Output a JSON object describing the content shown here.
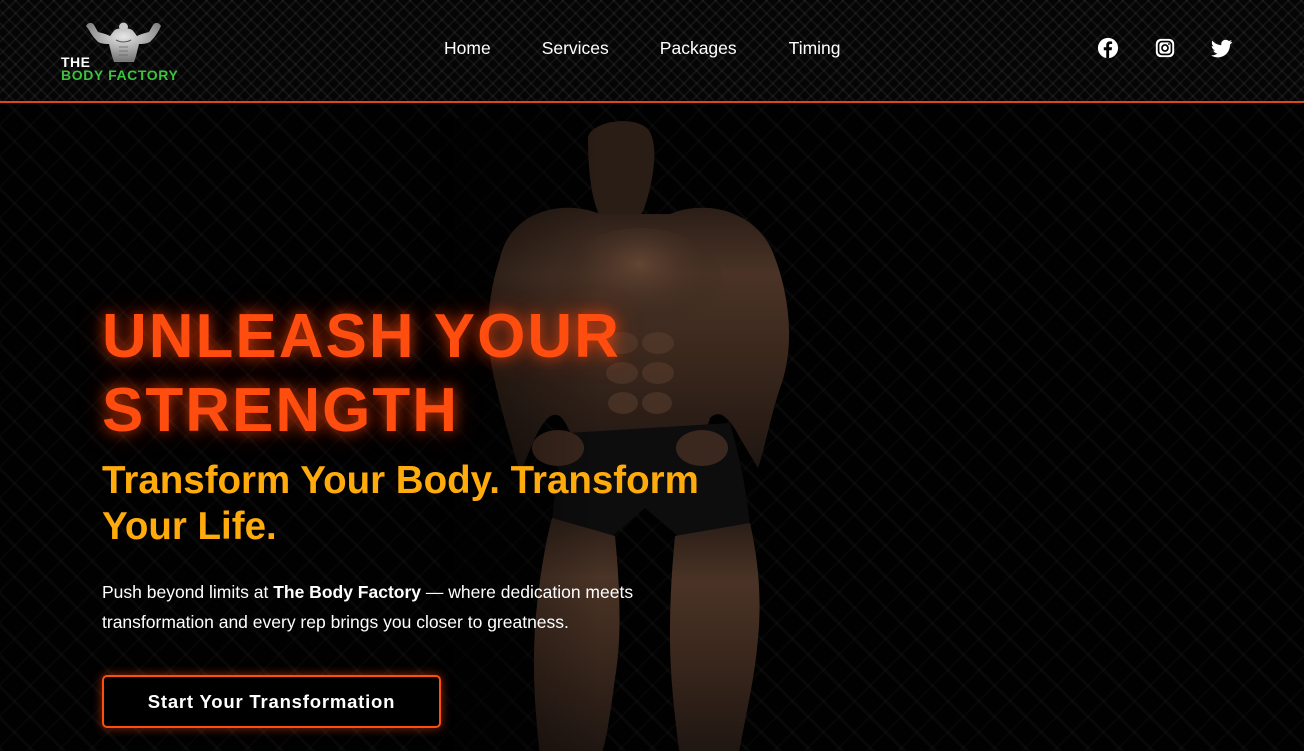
{
  "brand": {
    "logo_top": "THE",
    "logo_bottom": "BODY FACTORY",
    "logo_figure_icon": "flexing-bodybuilder-icon",
    "logo_green": "#3cc33c"
  },
  "nav": {
    "items": [
      {
        "label": "Home"
      },
      {
        "label": "Services"
      },
      {
        "label": "Packages"
      },
      {
        "label": "Timing"
      }
    ]
  },
  "social": [
    {
      "name": "facebook-icon"
    },
    {
      "name": "instagram-icon"
    },
    {
      "name": "twitter-icon"
    }
  ],
  "hero": {
    "title_line1": "UNLEASH YOUR",
    "title_line2": "STRENGTH",
    "subtitle": "Transform Your Body. Transform Your Life.",
    "desc_before": "Push beyond limits at ",
    "desc_bold": "The Body Factory",
    "desc_after": " — where dedication meets transformation and every rep brings you closer to greatness.",
    "cta": "Start Your Transformation",
    "image_icon": "bodybuilder-photo"
  },
  "colors": {
    "accent_orange": "#ff4c0f",
    "subtitle_amber": "#ffab0c",
    "header_border": "#e0441a",
    "background": "#000000"
  }
}
